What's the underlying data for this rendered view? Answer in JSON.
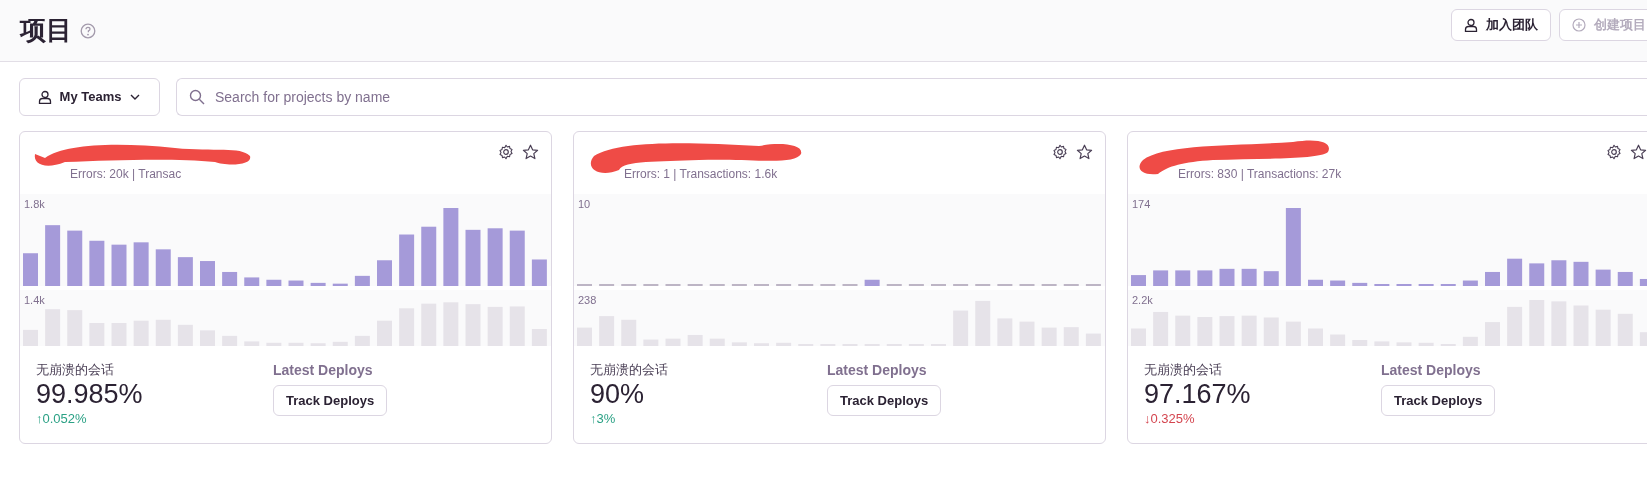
{
  "header": {
    "title": "项目",
    "buttons": [
      {
        "label": "加入团队",
        "kind": "join",
        "disabled": false
      },
      {
        "label": "创建项目",
        "kind": "create",
        "disabled": true
      }
    ]
  },
  "filters": {
    "team_button": "My Teams",
    "search": {
      "placeholder": "Search for projects by name"
    }
  },
  "projects": [
    {
      "stats": "Errors: 20k | Transac",
      "chart_top_label": "1.8k",
      "chart_bottom_label": "1.4k",
      "metric_label": "无崩溃的会话",
      "metric_value": "99.985%",
      "change": "↑0.052%",
      "increase": true,
      "deploys_label": "Latest Deploys",
      "deploys_button": "Track Deploys"
    },
    {
      "stats": "Errors: 1 | Transactions: 1.6k",
      "chart_top_label": "10",
      "chart_bottom_label": "238",
      "metric_label": "无崩溃的会话",
      "metric_value": "90%",
      "change": "↑3%",
      "increase": true,
      "deploys_label": "Latest Deploys",
      "deploys_button": "Track Deploys"
    },
    {
      "stats": "Errors: 830 | Transactions: 27k",
      "chart_top_label": "174",
      "chart_bottom_label": "2.2k",
      "metric_label": "无崩溃的会话",
      "metric_value": "97.167%",
      "change": "↓0.325%",
      "increase": false,
      "deploys_label": "Latest Deploys",
      "deploys_button": "Track Deploys"
    }
  ]
}
